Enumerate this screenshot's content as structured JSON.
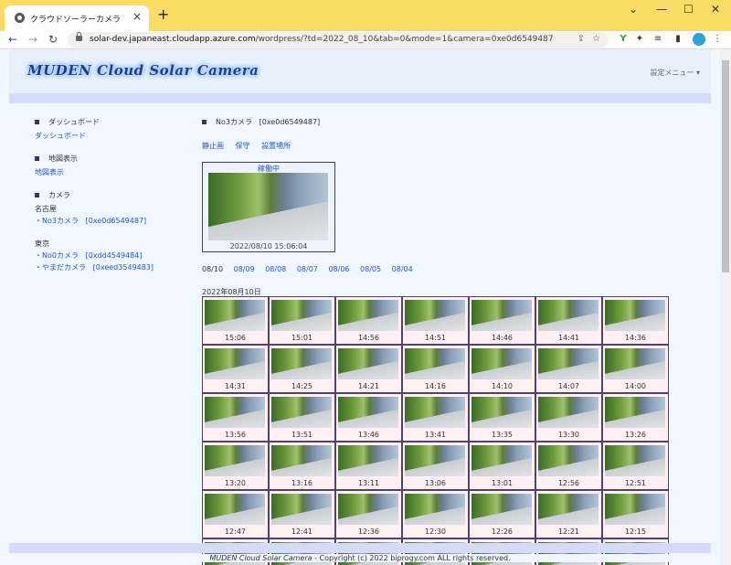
{
  "browser": {
    "tab_title": "クラウドソーラーカメラ",
    "tab_close": "×",
    "new_tab": "+",
    "url_host": "solar-dev.japaneast.cloudapp.azure.com",
    "url_path": "/wordpress/?td=2022_08_10&tab=0&mode=1&camera=0xe0d6549487"
  },
  "header": {
    "logo": "MUDEN Cloud Solar Camera",
    "settings_menu": "設定メニュー ▾"
  },
  "sidebar": {
    "dashboard_heading": "ダッシュボード",
    "dashboard_link": "ダッシュボード",
    "map_heading": "地図表示",
    "map_link": "地図表示",
    "camera_heading": "カメラ",
    "groups": [
      {
        "name": "名古屋",
        "cameras": [
          {
            "label": "・No3カメラ",
            "id": "[0xe0d6549487]"
          }
        ]
      },
      {
        "name": "東京",
        "cameras": [
          {
            "label": "・No0カメラ",
            "id": "[0xdd4549484]"
          },
          {
            "label": "・やまだカメラ",
            "id": "[0xeed3549483]"
          }
        ]
      }
    ]
  },
  "main": {
    "camera_label": "No3カメラ",
    "camera_id": "[0xe0d6549487]",
    "actions": [
      "静止画",
      "保守",
      "設置場所"
    ],
    "preview_status": "稼働中",
    "preview_timestamp": "2022/08/10 15:06:04",
    "dates": [
      "08/10",
      "08/09",
      "08/08",
      "08/07",
      "08/06",
      "08/05",
      "08/04"
    ],
    "day_heading": "2022年08月10日",
    "times": [
      "15:06",
      "15:01",
      "14:56",
      "14:51",
      "14:46",
      "14:41",
      "14:36",
      "14:31",
      "14:25",
      "14:21",
      "14:16",
      "14:10",
      "14:07",
      "14:00",
      "13:56",
      "13:51",
      "13:46",
      "13:41",
      "13:35",
      "13:30",
      "13:26",
      "13:20",
      "13:16",
      "13:11",
      "13:06",
      "13:01",
      "12:56",
      "12:51",
      "12:47",
      "12:41",
      "12:36",
      "12:30",
      "12:26",
      "12:21",
      "12:15"
    ]
  },
  "footer": {
    "brand": "MUDEN Cloud Solar Camera",
    "copyright": " - Copyright (c) 2022 biprogy.com ALL rights reserved."
  },
  "colors": {
    "tabbar": "#f9dc63",
    "link": "#2256c9",
    "page_bg": "#f0f7ff",
    "band": "#d5dcfa",
    "thumb_bg": "#fff0f3",
    "thumb_border": "#55406a"
  }
}
